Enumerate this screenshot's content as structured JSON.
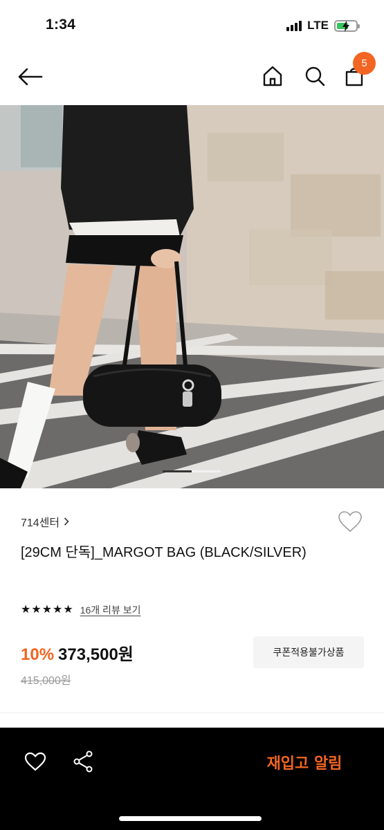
{
  "status_bar": {
    "time": "1:34",
    "network": "LTE",
    "battery_color": "#35c759"
  },
  "nav": {
    "back_icon": "arrow-left-icon",
    "home_icon": "home-icon",
    "search_icon": "search-icon",
    "cart_icon": "shopping-bag-icon",
    "cart_count": "5",
    "badge_color": "#f26522"
  },
  "hero": {
    "image_alt": "product-photo",
    "slide_count": 2,
    "active_slide": 1
  },
  "product": {
    "brand": "714센터",
    "title": "[29CM 단독]_MARGOT BAG (BLACK/SILVER)",
    "rating_stars": 5,
    "review_link": "16개 리뷰 보기",
    "discount": "10%",
    "price": "373,500원",
    "original_price": "415,000원",
    "coupon_note": "쿠폰적용불가상품"
  },
  "bottom_bar": {
    "wishlist_icon": "heart-icon",
    "share_icon": "share-icon",
    "restock_label": "재입고 알림",
    "accent_color": "#f26522"
  }
}
